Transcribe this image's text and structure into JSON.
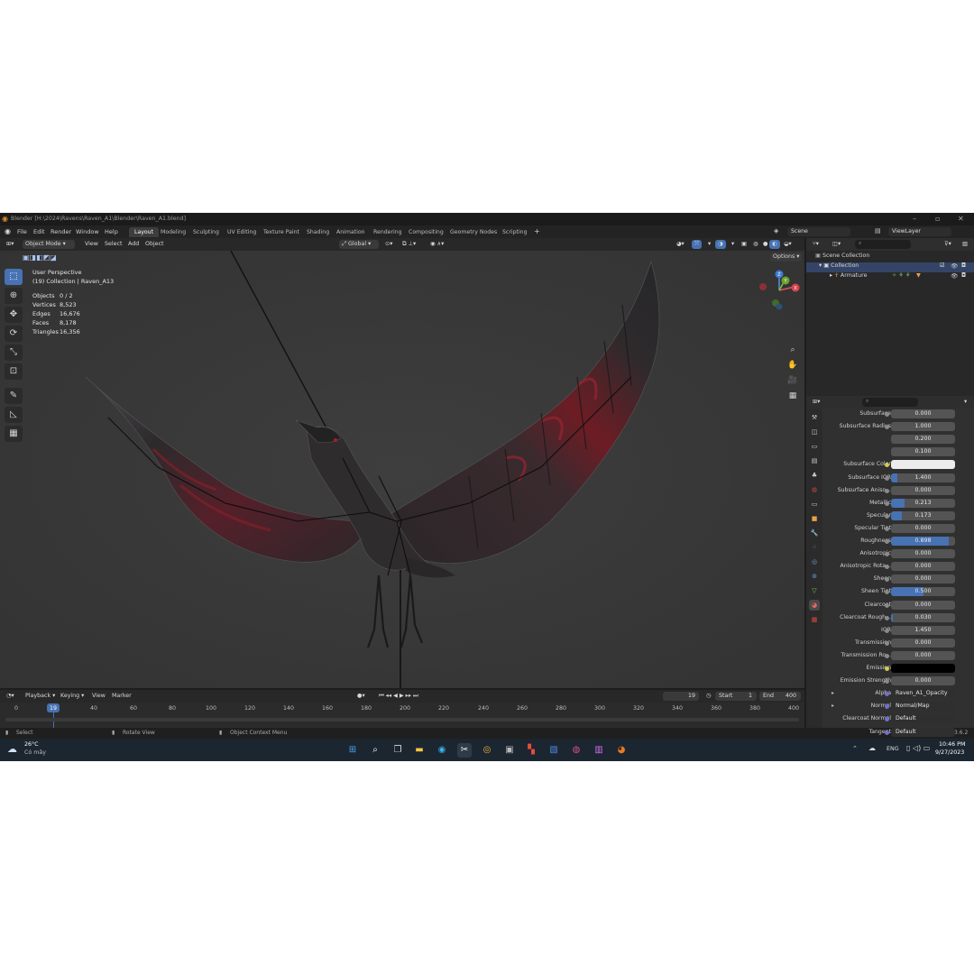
{
  "window": {
    "title": "Blender [H:\\2024\\Ravens\\Raven_A1\\Blender\\Raven_A1.blend]"
  },
  "menus": [
    "File",
    "Edit",
    "Render",
    "Window",
    "Help"
  ],
  "workspaces": [
    "Layout",
    "Modeling",
    "Sculpting",
    "UV Editing",
    "Texture Paint",
    "Shading",
    "Animation",
    "Rendering",
    "Compositing",
    "Geometry Nodes",
    "Scripting"
  ],
  "active_workspace": "Layout",
  "scene": {
    "name": "Scene",
    "view_layer": "ViewLayer"
  },
  "viewport_header": {
    "mode": "Object Mode",
    "menus": [
      "View",
      "Select",
      "Add",
      "Object"
    ],
    "transform_orientation": "Global",
    "options": "Options"
  },
  "viewport": {
    "perspective": "User Perspective",
    "collection_line": "(19) Collection | Raven_A13",
    "stats": [
      {
        "label": "Objects",
        "value": "0 / 2"
      },
      {
        "label": "Vertices",
        "value": "8,523"
      },
      {
        "label": "Edges",
        "value": "16,676"
      },
      {
        "label": "Faces",
        "value": "8,178"
      },
      {
        "label": "Triangles",
        "value": "16,356"
      }
    ],
    "gizmo": {
      "z": "Z",
      "y": "Y",
      "x": "X"
    }
  },
  "timeline": {
    "menus": [
      "Playback",
      "Keying",
      "View",
      "Marker"
    ],
    "current_frame": "19",
    "start_label": "Start",
    "start": "1",
    "end_label": "End",
    "end": "400",
    "ticks": [
      "0",
      "19",
      "40",
      "60",
      "80",
      "100",
      "120",
      "140",
      "160",
      "180",
      "200",
      "220",
      "240",
      "260",
      "280",
      "300",
      "320",
      "340",
      "360",
      "380",
      "400"
    ]
  },
  "statusbar": {
    "select": "Select",
    "rotate": "Rotate View",
    "context": "Object Context Menu",
    "version": "3.6.2"
  },
  "outliner": {
    "rows": [
      {
        "label": "Scene Collection"
      },
      {
        "label": "Collection"
      },
      {
        "label": "Armature"
      }
    ]
  },
  "properties": {
    "rows": [
      {
        "label": "Subsurface",
        "value": "0.000",
        "fill": 0
      },
      {
        "label": "Subsurface Radius",
        "value": "1.000",
        "fill": 0
      },
      {
        "label": "",
        "value": "0.200",
        "fill": 0
      },
      {
        "label": "",
        "value": "0.100",
        "fill": 0
      },
      {
        "label": "Subsurface Color",
        "value": "",
        "fill": 0,
        "swatch": "#ececec"
      },
      {
        "label": "Subsurface IOR",
        "value": "1.400",
        "fill": 0.1
      },
      {
        "label": "Subsurface Aniso...",
        "value": "0.000",
        "fill": 0
      },
      {
        "label": "Metallic",
        "value": "0.213",
        "fill": 0.213
      },
      {
        "label": "Specular",
        "value": "0.173",
        "fill": 0.173
      },
      {
        "label": "Specular Tint",
        "value": "0.000",
        "fill": 0
      },
      {
        "label": "Roughness",
        "value": "0.898",
        "fill": 0.898
      },
      {
        "label": "Anisotropic",
        "value": "0.000",
        "fill": 0
      },
      {
        "label": "Anisotropic Rota...",
        "value": "0.000",
        "fill": 0
      },
      {
        "label": "Sheen",
        "value": "0.000",
        "fill": 0
      },
      {
        "label": "Sheen Tint",
        "value": "0.500",
        "fill": 0.5
      },
      {
        "label": "Clearcoat",
        "value": "0.000",
        "fill": 0
      },
      {
        "label": "Clearcoat Rough...",
        "value": "0.030",
        "fill": 0.03
      },
      {
        "label": "IOR",
        "value": "1.450",
        "fill": 0
      },
      {
        "label": "Transmission",
        "value": "0.000",
        "fill": 0
      },
      {
        "label": "Transmission Ro...",
        "value": "0.000",
        "fill": 0
      },
      {
        "label": "Emission",
        "value": "",
        "fill": 0,
        "swatch": "#000000"
      },
      {
        "label": "Emission Strength",
        "value": "0.000",
        "fill": 0
      },
      {
        "label": "Alpha",
        "value": "Raven_A1_Opacity",
        "text": true,
        "arrow": true
      },
      {
        "label": "Normal",
        "value": "Normal/Map",
        "text": true,
        "arrow": true
      },
      {
        "label": "Clearcoat Normal",
        "value": "Default",
        "text": true
      },
      {
        "label": "Tangent",
        "value": "Default",
        "text": true
      }
    ]
  },
  "taskbar": {
    "weather_temp": "26°C",
    "weather_desc": "Có mây",
    "lang": "ENG",
    "time": "10:46 PM",
    "date": "9/27/2023"
  },
  "colors": {
    "accent": "#4772b3",
    "raven_red": "#8a1d24"
  }
}
